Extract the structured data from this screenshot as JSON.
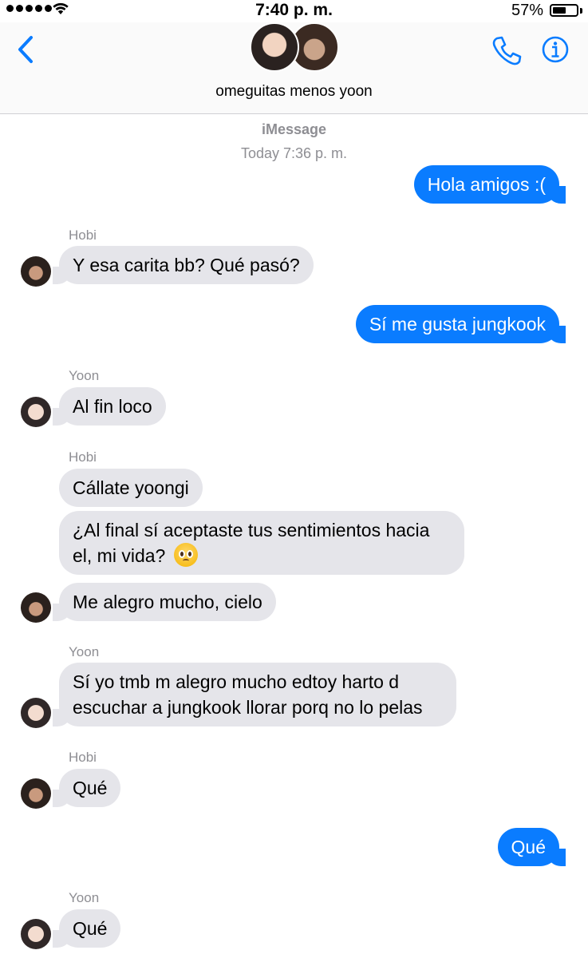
{
  "status_bar": {
    "time": "7:40 p. m.",
    "battery_percent": "57%",
    "battery_level": 0.57,
    "signal_icon": "signal-dots-icon",
    "wifi_icon": "wifi-icon"
  },
  "header": {
    "group_name": "omeguitas menos yoon",
    "back_icon": "chevron-left-icon",
    "call_icon": "phone-icon",
    "info_icon": "info-icon",
    "accent_color": "#0a7cff"
  },
  "conversation": {
    "service": "iMessage",
    "timestamp": "Today 7:36 p. m."
  },
  "messages": [
    {
      "direction": "outgoing",
      "text": "Hola amigos :("
    },
    {
      "direction": "incoming",
      "sender": "Hobi",
      "text": "Y esa carita bb? Qué pasó?"
    },
    {
      "direction": "outgoing",
      "text": "Sí me gusta jungkook"
    },
    {
      "direction": "incoming",
      "sender": "Yoon",
      "text": "Al fin loco"
    },
    {
      "direction": "incoming",
      "sender": "Hobi",
      "text": "Cállate yoongi"
    },
    {
      "direction": "incoming",
      "sender": "Hobi",
      "text_line1": "¿Al final sí aceptaste tus sentimientos hacia",
      "text_line2": "el, mi vida?",
      "emoji": "pleading-face-emoji"
    },
    {
      "direction": "incoming",
      "sender": "Hobi",
      "text": "Me alegro mucho, cielo"
    },
    {
      "direction": "incoming",
      "sender": "Yoon",
      "text_line1": "Sí yo tmb m alegro mucho edtoy harto d",
      "text_line2": "escuchar a jungkook llorar porq no lo pelas"
    },
    {
      "direction": "incoming",
      "sender": "Hobi",
      "text": "Qué"
    },
    {
      "direction": "outgoing",
      "text": "Qué"
    },
    {
      "direction": "incoming",
      "sender": "Yoon",
      "text": "Qué"
    }
  ]
}
